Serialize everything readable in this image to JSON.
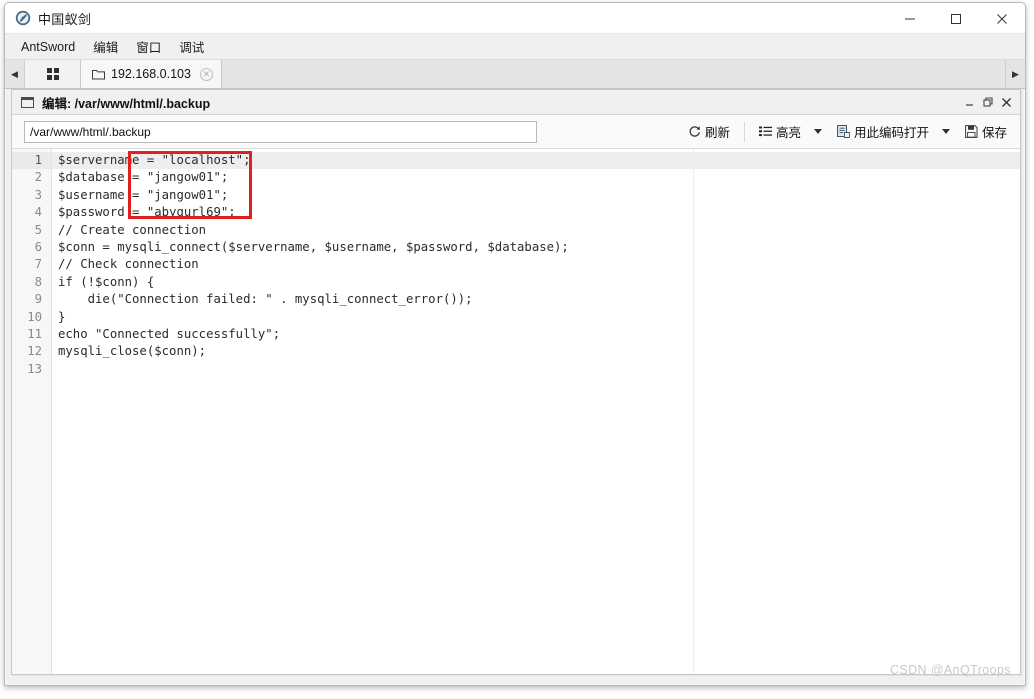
{
  "window": {
    "title": "中国蚁剑",
    "app_icon": "antsword-logo-icon",
    "minimize_label": "—",
    "maximize_label": "□",
    "close_label": "✕"
  },
  "menubar": {
    "items": [
      {
        "label": "AntSword",
        "name": "menu-antsword"
      },
      {
        "label": "编辑",
        "name": "menu-edit"
      },
      {
        "label": "窗口",
        "name": "menu-window"
      },
      {
        "label": "调试",
        "name": "menu-debug"
      }
    ]
  },
  "tabbar": {
    "scroll_left": "◀",
    "scroll_right": "▶",
    "home_icon": "grid-icon",
    "tabs": [
      {
        "label": "192.168.0.103",
        "icon": "folder-icon",
        "close": "✕",
        "active": true
      }
    ]
  },
  "panel": {
    "title_prefix": "编辑: ",
    "title_path": "/var/www/html/.backup",
    "title": "编辑: /var/www/html/.backup",
    "minimize_label": "_",
    "restore_label": "❐",
    "close_label": "✕"
  },
  "toolbar": {
    "path_value": "/var/www/html/.backup",
    "path_placeholder": "/var/www/html/",
    "refresh_label": "刷新",
    "refresh_icon": "refresh-icon",
    "highlight_label": "高亮",
    "highlight_icon": "list-icon",
    "encoding_label": "用此编码打开",
    "encoding_icon": "encoding-icon",
    "save_label": "保存",
    "save_icon": "floppy-icon"
  },
  "editor": {
    "active_line": 1,
    "line_numbers": [
      "1",
      "2",
      "3",
      "4",
      "5",
      "6",
      "7",
      "8",
      "9",
      "10",
      "11",
      "12",
      "13"
    ],
    "lines": [
      "$servername = \"localhost\";",
      "$database = \"jangow01\";",
      "$username = \"jangow01\";",
      "$password = \"abygurl69\";",
      "// Create connection",
      "$conn = mysqli_connect($servername, $username, $password, $database);",
      "// Check connection",
      "if (!$conn) {",
      "    die(\"Connection failed: \" . mysqli_connect_error());",
      "}",
      "echo \"Connected successfully\";",
      "mysqli_close($conn);",
      ""
    ]
  },
  "annotation": {
    "type": "red-rectangle",
    "covers_lines": "1-4",
    "color": "#e02020"
  },
  "watermark": {
    "text": "CSDN @AnQTroops"
  }
}
